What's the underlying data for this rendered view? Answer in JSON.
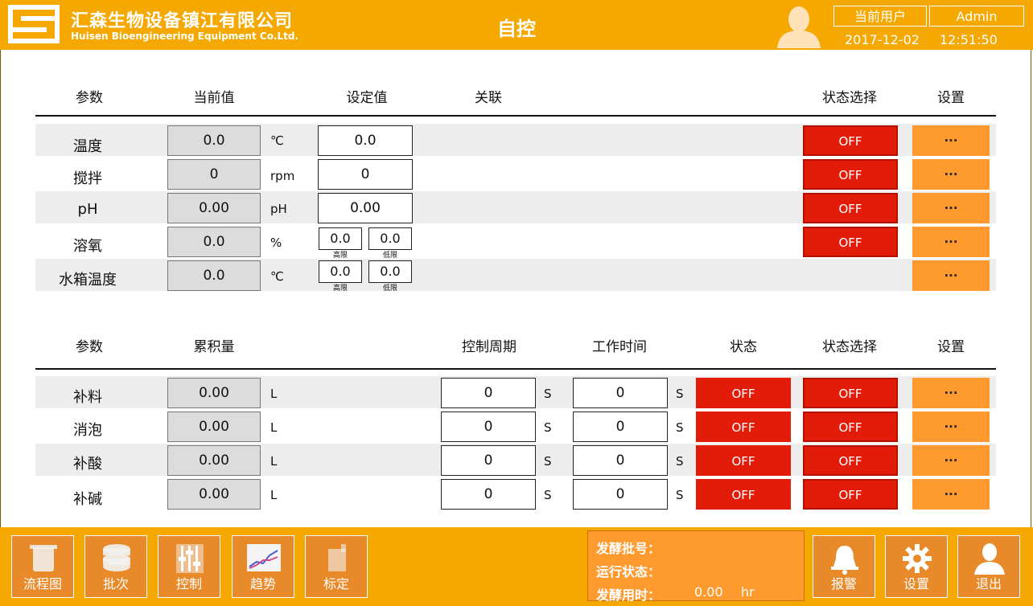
{
  "header": {
    "company_cn": "汇森生物设备镇江有限公司",
    "company_en": "Huisen Bioengineering Equipment Co.Ltd.",
    "title": "自控",
    "user_label": "当前用户",
    "user_name": "Admin",
    "date": "2017-12-02",
    "time": "12:51:50"
  },
  "table1": {
    "headers": {
      "param": "参数",
      "current": "当前值",
      "setpoint": "设定值",
      "link": "关联",
      "state_select": "状态选择",
      "settings": "设置"
    },
    "rows": [
      {
        "name": "温度",
        "current": "0.0",
        "unit": "℃",
        "set": "0.0",
        "state": "OFF",
        "btn": "..."
      },
      {
        "name": "搅拌",
        "current": "0",
        "unit": "rpm",
        "set": "0",
        "state": "OFF",
        "btn": "..."
      },
      {
        "name": "pH",
        "current": "0.00",
        "unit": "pH",
        "set": "0.00",
        "state": "OFF",
        "btn": "..."
      },
      {
        "name": "溶氧",
        "current": "0.0",
        "unit": "%",
        "high": "0.0",
        "low": "0.0",
        "high_label": "高限",
        "low_label": "低限",
        "state": "OFF",
        "btn": "..."
      },
      {
        "name": "水箱温度",
        "current": "0.0",
        "unit": "℃",
        "high": "0.0",
        "low": "0.0",
        "high_label": "高限",
        "low_label": "低限",
        "btn": "..."
      }
    ]
  },
  "table2": {
    "headers": {
      "param": "参数",
      "total": "累积量",
      "period": "控制周期",
      "worktime": "工作时间",
      "status": "状态",
      "state_select": "状态选择",
      "settings": "设置"
    },
    "rows": [
      {
        "name": "补料",
        "total": "0.00",
        "unit": "L",
        "period": "0",
        "period_unit": "S",
        "work": "0",
        "work_unit": "S",
        "status": "OFF",
        "state": "OFF",
        "btn": "..."
      },
      {
        "name": "消泡",
        "total": "0.00",
        "unit": "L",
        "period": "0",
        "period_unit": "S",
        "work": "0",
        "work_unit": "S",
        "status": "OFF",
        "state": "OFF",
        "btn": "..."
      },
      {
        "name": "补酸",
        "total": "0.00",
        "unit": "L",
        "period": "0",
        "period_unit": "S",
        "work": "0",
        "work_unit": "S",
        "status": "OFF",
        "state": "OFF",
        "btn": "..."
      },
      {
        "name": "补碱",
        "total": "0.00",
        "unit": "L",
        "period": "0",
        "period_unit": "S",
        "work": "0",
        "work_unit": "S",
        "status": "OFF",
        "state": "OFF",
        "btn": "..."
      }
    ]
  },
  "footer": {
    "nav": [
      "流程图",
      "批次",
      "控制",
      "趋势",
      "标定"
    ],
    "batch_label": "发酵批号：",
    "run_label": "运行状态：",
    "time_label": "发酵用时：",
    "time_value": "0.00",
    "time_unit": "hr",
    "alarm": "报警",
    "settings": "设置",
    "exit": "退出"
  },
  "colors": {
    "header": "#f5a800",
    "off": "#e31c0a",
    "setting": "#ff9a2e"
  }
}
